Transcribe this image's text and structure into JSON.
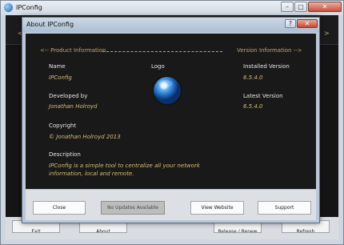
{
  "main_window": {
    "title": "IPConfig",
    "controls": {
      "minimize": "–",
      "maximize": "□",
      "close": "✕"
    },
    "background_buttons": [
      "Exit",
      "About",
      "Release / Renew",
      "Refresh"
    ]
  },
  "about_dialog": {
    "title": "About IPConfig",
    "help_glyph": "?",
    "close_glyph": "✕",
    "product_header": "<-- Product Information",
    "version_header": "Version Information -->",
    "name_label": "Name",
    "name_value": "IPConfig",
    "logo_label": "Logo",
    "developed_label": "Developed by",
    "developed_value": "Jonathan Holroyd",
    "copyright_label": "Copyright",
    "copyright_value": "© Jonathan Holroyd 2013",
    "description_label": "Description",
    "description_value": "IPConfig is a simple tool to centralize all your network information, local and remote.",
    "installed_label": "Installed Version",
    "installed_value": "6.5.4.0",
    "latest_label": "Latest Version",
    "latest_value": "6.5.4.0",
    "buttons": {
      "close": "Close",
      "updates": "No Updates Available",
      "website": "View Website",
      "support": "Support"
    }
  },
  "colors": {
    "accent": "#c3a46a",
    "value_text": "#d6bd72",
    "dialog_bg": "#191919"
  },
  "icons": {
    "app": "globe-icon",
    "logo": "globe-logo"
  }
}
